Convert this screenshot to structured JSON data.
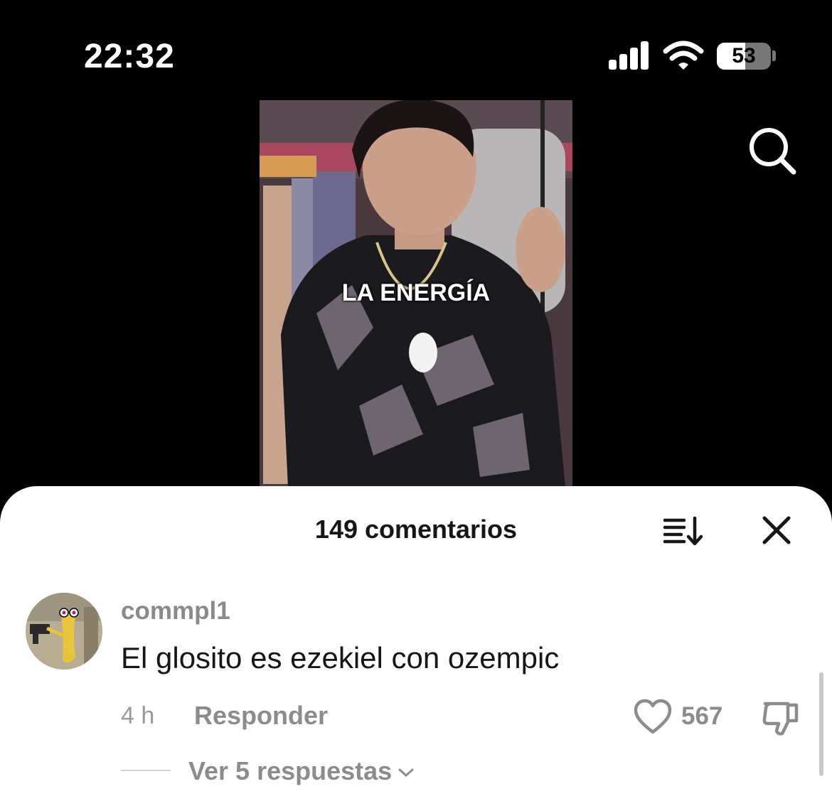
{
  "status_bar": {
    "time": "22:32",
    "battery_percent": "53",
    "battery_level": 0.53
  },
  "icons": {
    "signal": "cellular-signal-icon",
    "wifi": "wifi-icon",
    "search": "search-icon",
    "sort": "sort-icon",
    "close": "close-icon",
    "like": "heart-icon",
    "dislike": "thumbs-down-icon",
    "chevron": "chevron-down-icon"
  },
  "video": {
    "caption": "LA ENERGÍA"
  },
  "comments": {
    "title": "149 comentarios",
    "items": [
      {
        "username": "commpl1",
        "text": "El glosito es ezekiel con ozempic",
        "time_ago": "4 h",
        "reply_label": "Responder",
        "likes": "567",
        "view_replies_label": "Ver 5 respuestas"
      }
    ]
  },
  "colors": {
    "background": "#000000",
    "sheet": "#ffffff",
    "primary_text": "#161616",
    "secondary_text": "#8c8c8c"
  }
}
